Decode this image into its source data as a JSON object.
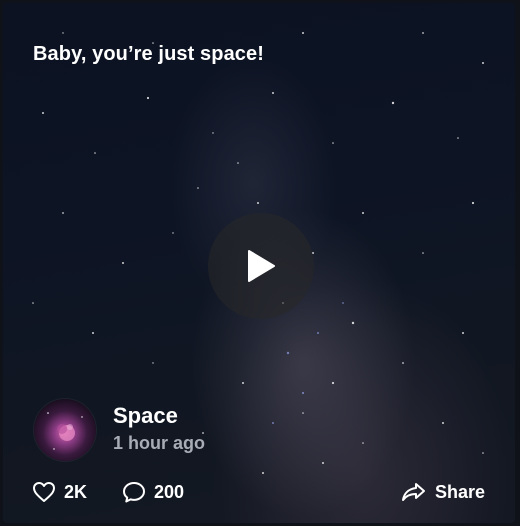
{
  "post": {
    "caption": "Baby, you’re just space!",
    "author": "Space",
    "time": "1 hour ago"
  },
  "actions": {
    "likes": "2K",
    "comments": "200",
    "share": "Share"
  },
  "icons": {
    "play": "play-icon",
    "like": "heart-icon",
    "comment": "comment-icon",
    "share": "share-icon"
  },
  "colors": {
    "text": "#ffffff",
    "muted": "#a7acb5"
  }
}
